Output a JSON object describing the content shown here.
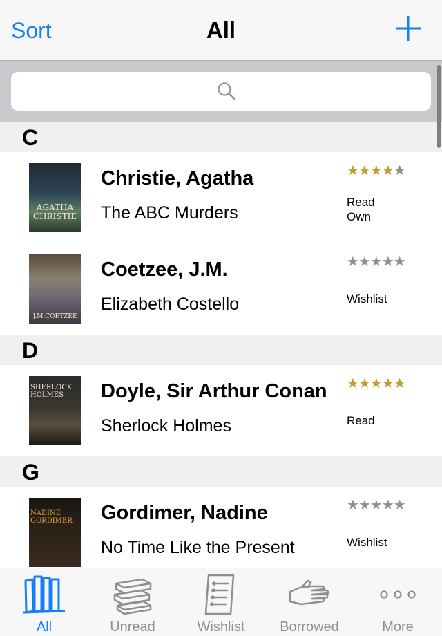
{
  "navbar": {
    "left_label": "Sort",
    "title": "All",
    "add_icon": "plus-icon"
  },
  "search": {
    "placeholder": "",
    "icon": "search-icon"
  },
  "colors": {
    "accent": "#157efb",
    "star_on": "#c69c32",
    "star_off": "#8e8e93",
    "section_bg": "#f0f0f0"
  },
  "sections": [
    {
      "letter": "C",
      "books": [
        {
          "author": "Christie, Agatha",
          "title": "The ABC Murders",
          "rating": 4,
          "status": "Read\nOwn",
          "cover_text": "AGATHA CHRISTIE"
        },
        {
          "author": "Coetzee, J.M.",
          "title": "Elizabeth Costello",
          "rating": 0,
          "status": "Wishlist",
          "cover_text": "J.M.COETZEE"
        }
      ]
    },
    {
      "letter": "D",
      "books": [
        {
          "author": "Doyle, Sir Arthur Conan",
          "title": "Sherlock Holmes",
          "rating": 5,
          "status": "Read",
          "cover_text": "SHERLOCK HOLMES"
        }
      ]
    },
    {
      "letter": "G",
      "books": [
        {
          "author": "Gordimer, Nadine",
          "title": "No Time Like the Present",
          "rating": 0,
          "status": "Wishlist",
          "cover_text": "NADINE GORDIMER"
        }
      ]
    }
  ],
  "tabs": [
    {
      "label": "All",
      "icon": "books-shelf-icon",
      "active": true
    },
    {
      "label": "Unread",
      "icon": "book-stack-icon",
      "active": false
    },
    {
      "label": "Wishlist",
      "icon": "list-document-icon",
      "active": false
    },
    {
      "label": "Borrowed",
      "icon": "hand-icon",
      "active": false
    },
    {
      "label": "More",
      "icon": "more-dots-icon",
      "active": false
    }
  ]
}
